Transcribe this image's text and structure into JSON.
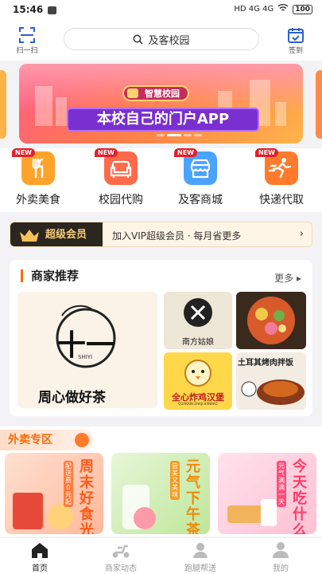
{
  "status_bar": {
    "time": "15:46",
    "network": "HD 4G 4G",
    "battery": "100"
  },
  "header": {
    "scan_label": "扫一扫",
    "search_text": "及客校园",
    "checkin_label": "签到"
  },
  "banner": {
    "brand": "智慧校园",
    "slogan": "本校自己的门户APP",
    "active_slide": 2,
    "slides": 4
  },
  "categories": [
    {
      "label": "外卖美食",
      "badge": "NEW",
      "color": "#ffa32b",
      "icon": "fork-knife-icon"
    },
    {
      "label": "校园代购",
      "badge": "NEW",
      "color": "#ff6a4a",
      "icon": "sofa-icon"
    },
    {
      "label": "及客商城",
      "badge": "NEW",
      "color": "#4aa3ff",
      "icon": "store-icon"
    },
    {
      "label": "快递代取",
      "badge": "NEW",
      "color": "#ff7a2a",
      "icon": "delivery-runner-icon"
    }
  ],
  "vip": {
    "tag": "超级会员",
    "text": "加入VIP超级会员 · 每月省更多"
  },
  "merchants": {
    "title": "商家推荐",
    "more": "更多",
    "items": [
      {
        "name": "周心做好茶",
        "logo_text": "十一",
        "sub": "SHIYI"
      },
      {
        "name": "南方姑娘"
      },
      {
        "name": "全心炸鸡汉堡",
        "sub": "QUANXIN ZHAJI HANBAO"
      },
      {
        "name": "土耳其烤肉拌饭"
      }
    ]
  },
  "waimai": {
    "title": "外卖专区",
    "posters": [
      {
        "big": "周末好食光",
        "small": "配送费0元起",
        "colors": [
          "#ffe0d0",
          "#ffb89a"
        ],
        "accent": "#ff7a3a"
      },
      {
        "big": "元气下午茶",
        "small": "尝美又美味",
        "colors": [
          "#e6f6d8",
          "#bfe79a"
        ],
        "accent": "#f59a1e"
      },
      {
        "big": "今天吃什么",
        "small": "元气满满一天",
        "colors": [
          "#ffe2ec",
          "#ffc0d3"
        ],
        "accent": "#ff4d7a"
      }
    ]
  },
  "tabbar": [
    {
      "label": "首页",
      "active": true
    },
    {
      "label": "商家动态",
      "active": false
    },
    {
      "label": "跑腿帮送",
      "active": false
    },
    {
      "label": "我的",
      "active": false
    }
  ]
}
